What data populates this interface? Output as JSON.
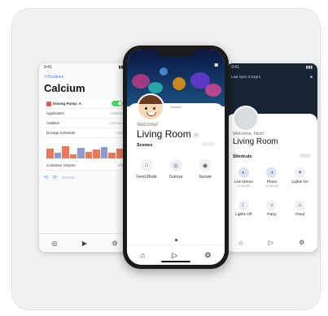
{
  "left_screen": {
    "time": "9:41",
    "back_label": "< Routines",
    "title": "Calcium",
    "dosing_pump": "Dosing Pump: A",
    "rows": [
      {
        "label": "Application",
        "value": "Additive"
      },
      {
        "label": "Additive",
        "value": "Calcium"
      },
      {
        "label": "Dosage Schedule",
        "value": "Auto"
      }
    ],
    "container_label": "Container Volume",
    "container_value": "Fill",
    "schedule_bars": [
      0.55,
      0.3,
      0.7,
      0.25,
      0.6,
      0.35,
      0.5,
      0.65,
      0.3,
      0.55
    ],
    "tools_text": "Refresh"
  },
  "right_screen": {
    "time": "9:41",
    "top_text": "Last Sync 9:41pm",
    "welcome": "Welcome, Nick!",
    "room": "Living Room",
    "section": "Shortcuts",
    "shortcuts": [
      {
        "label": "Live Demo",
        "sub": "12 min left",
        "icon": "◐",
        "active": true
      },
      {
        "label": "Photo",
        "sub": "15 min left",
        "icon": "◑",
        "active": true
      },
      {
        "label": "Lights On",
        "sub": "",
        "icon": "☀",
        "active": false
      },
      {
        "label": "Lights Off",
        "sub": "",
        "icon": "☾",
        "active": false
      },
      {
        "label": "Party",
        "sub": "",
        "icon": "♪",
        "active": false
      },
      {
        "label": "Feed",
        "sub": "",
        "icon": "♨",
        "active": false
      }
    ]
  },
  "center_screen": {
    "welcome": "Welcome!",
    "room": "Living Room",
    "section": "Scenes",
    "scenes": [
      {
        "label": "Feed Mode",
        "icon": "⌂"
      },
      {
        "label": "Sunrise",
        "icon": "◎"
      },
      {
        "label": "Sunset",
        "icon": "◉"
      }
    ]
  },
  "colors": {
    "accent": "#1e3a8a",
    "toggle_on": "#4cd964",
    "bar_primary": "#e8795c",
    "bar_secondary": "#8e9ad0"
  }
}
